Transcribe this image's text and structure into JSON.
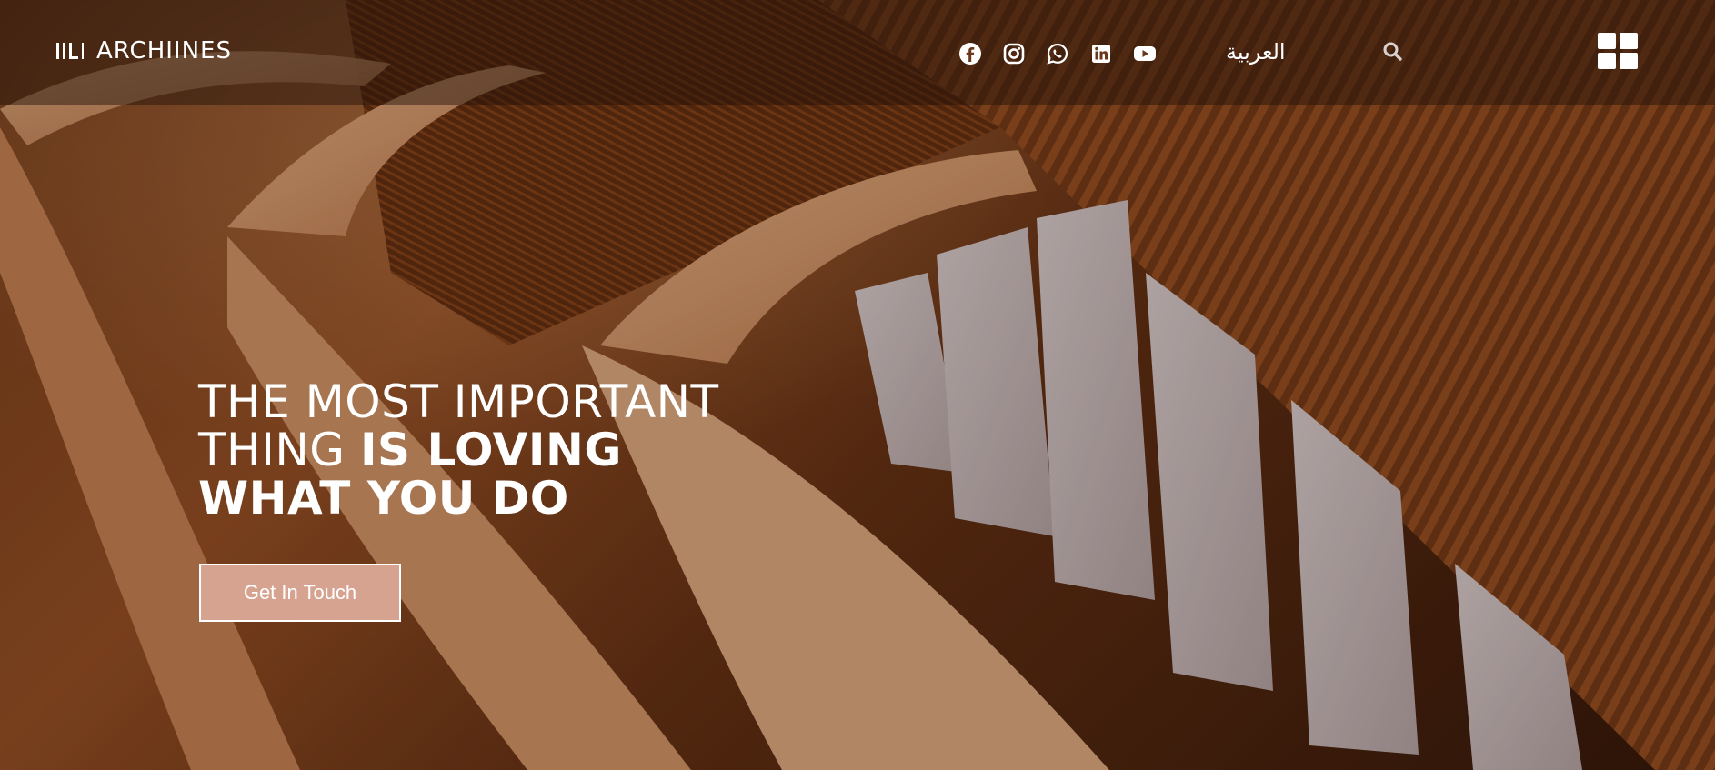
{
  "header": {
    "logo_text": "ARCHIINES",
    "language_label": "العربية"
  },
  "social_links": [
    {
      "icon": "facebook-icon"
    },
    {
      "icon": "instagram-icon"
    },
    {
      "icon": "whatsapp-icon"
    },
    {
      "icon": "linkedin-icon"
    },
    {
      "icon": "youtube-icon"
    }
  ],
  "hero": {
    "line1": "THE MOST IMPORTANT",
    "line2_light": "THING ",
    "line2_bold": "IS LOVING",
    "line3": "WHAT YOU DO",
    "cta_label": "Get In Touch"
  },
  "colors": {
    "text": "#ffffff",
    "cta_background": "#d6a391",
    "topbar_overlay": "rgba(30,16,8,0.45)"
  }
}
